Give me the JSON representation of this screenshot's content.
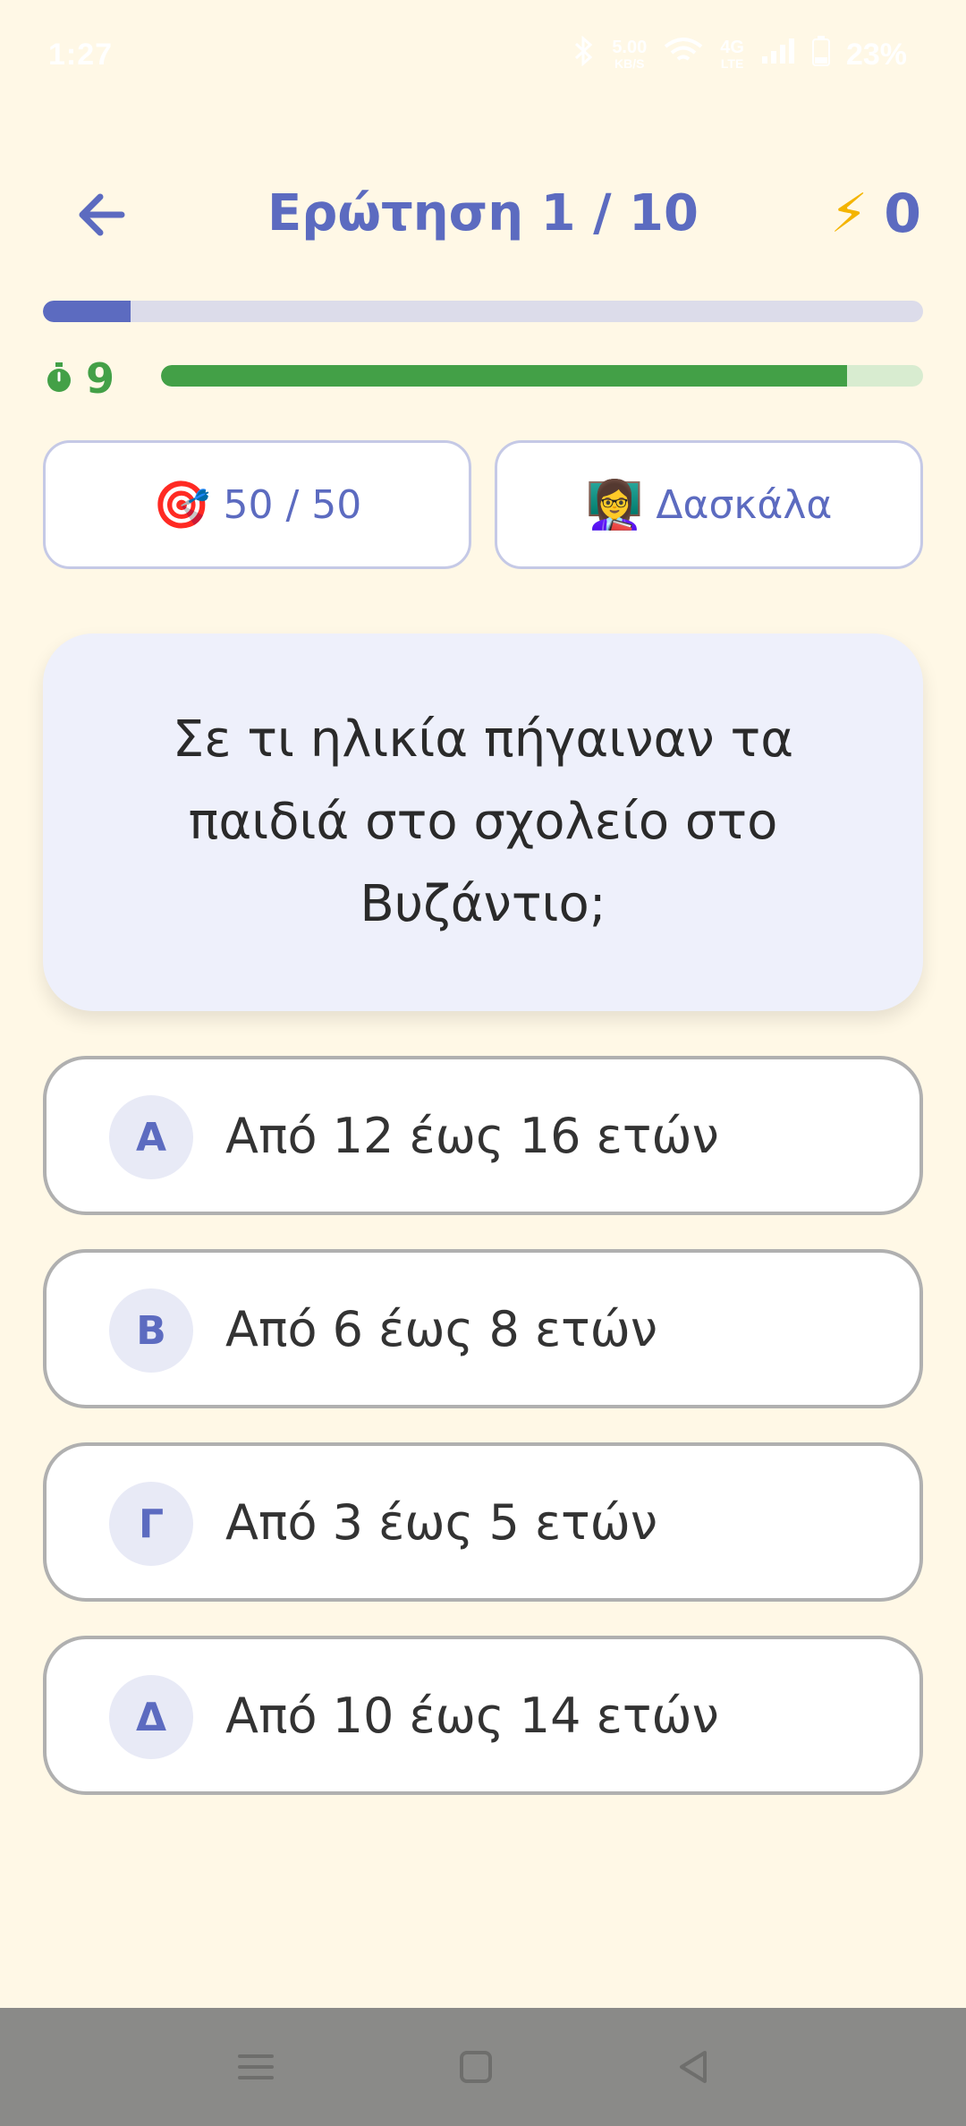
{
  "status_bar": {
    "time": "1:27",
    "network_speed_value": "5.00",
    "network_speed_unit": "KB/S",
    "network_type": "4G",
    "network_sub": "LTE",
    "battery": "23%"
  },
  "header": {
    "question_counter": "Ερώτηση 1 / 10",
    "score": "0",
    "back_icon": "arrow-left-icon",
    "score_icon": "lightning-icon"
  },
  "progress": {
    "current": 1,
    "total": 10,
    "fraction": 0.1
  },
  "timer": {
    "seconds": "9",
    "remaining_fraction": 0.9,
    "icon": "stopwatch-icon"
  },
  "lifelines": {
    "fifty_fifty": {
      "emoji": "🎯",
      "label": "50 / 50"
    },
    "teacher": {
      "emoji": "👩‍🏫",
      "label": "Δασκάλα"
    }
  },
  "question": {
    "text": "Σε τι ηλικία πήγαιναν τα παιδιά στο σχολείο στο Βυζάντιο;"
  },
  "answers": [
    {
      "letter": "Α",
      "text": "Από 12 έως 16 ετών"
    },
    {
      "letter": "Β",
      "text": "Από 6 έως 8 ετών"
    },
    {
      "letter": "Γ",
      "text": "Από 3 έως 5 ετών"
    },
    {
      "letter": "Δ",
      "text": "Από 10 έως 14 ετών"
    }
  ],
  "nav_bar": {
    "menu_icon": "menu-icon",
    "home_icon": "home-square-icon",
    "back_icon": "back-triangle-icon"
  },
  "colors": {
    "background": "#fff8e6",
    "accent": "#5c6bc0",
    "timer_green": "#43a047",
    "question_card": "#eef0fb",
    "nav_bar": "#8a8a88"
  }
}
